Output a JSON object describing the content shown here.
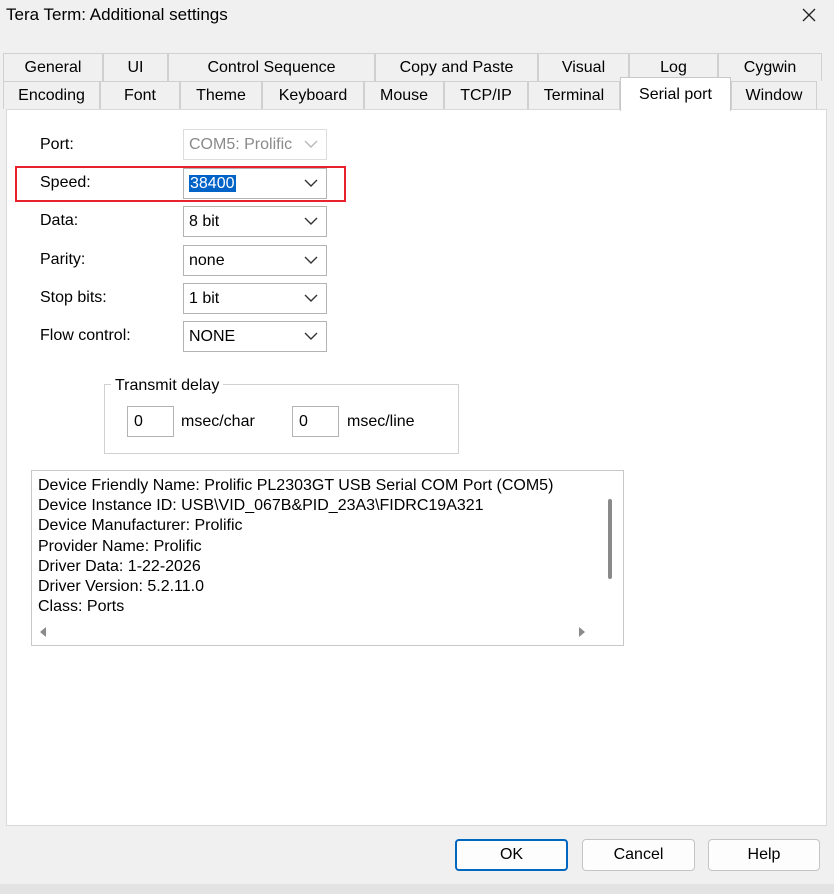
{
  "window": {
    "title": "Tera Term: Additional settings"
  },
  "tabs": {
    "row_back": [
      "General",
      "UI",
      "Control Sequence",
      "Copy and Paste",
      "Visual",
      "Log",
      "Cygwin"
    ],
    "row_front": [
      "Encoding",
      "Font",
      "Theme",
      "Keyboard",
      "Mouse",
      "TCP/IP",
      "Terminal",
      "Serial port",
      "Window"
    ],
    "active": "Serial port"
  },
  "serial": {
    "port": {
      "label": "Port:",
      "value": "COM5: Prolific"
    },
    "speed": {
      "label": "Speed:",
      "value": "38400"
    },
    "data": {
      "label": "Data:",
      "value": "8 bit"
    },
    "parity": {
      "label": "Parity:",
      "value": "none"
    },
    "stop_bits": {
      "label": "Stop bits:",
      "value": "1 bit"
    },
    "flow_control": {
      "label": "Flow control:",
      "value": "NONE"
    }
  },
  "transmit_delay": {
    "legend": "Transmit delay",
    "char_value": "0",
    "char_unit": "msec/char",
    "line_value": "0",
    "line_unit": "msec/line"
  },
  "device_info": [
    "Device Friendly Name: Prolific PL2303GT USB Serial COM Port (COM5)",
    "Device Instance ID: USB\\VID_067B&PID_23A3\\FIDRC19A321",
    "Device Manufacturer: Prolific",
    "Provider Name: Prolific",
    "Driver Data: 1-22-2026",
    "Driver Version: 5.2.11.0",
    "Class: Ports"
  ],
  "buttons": {
    "ok": "OK",
    "cancel": "Cancel",
    "help": "Help"
  },
  "colors": {
    "highlight": "#e8212b",
    "selection": "#0063c8",
    "default_button_border": "#0067c0"
  }
}
